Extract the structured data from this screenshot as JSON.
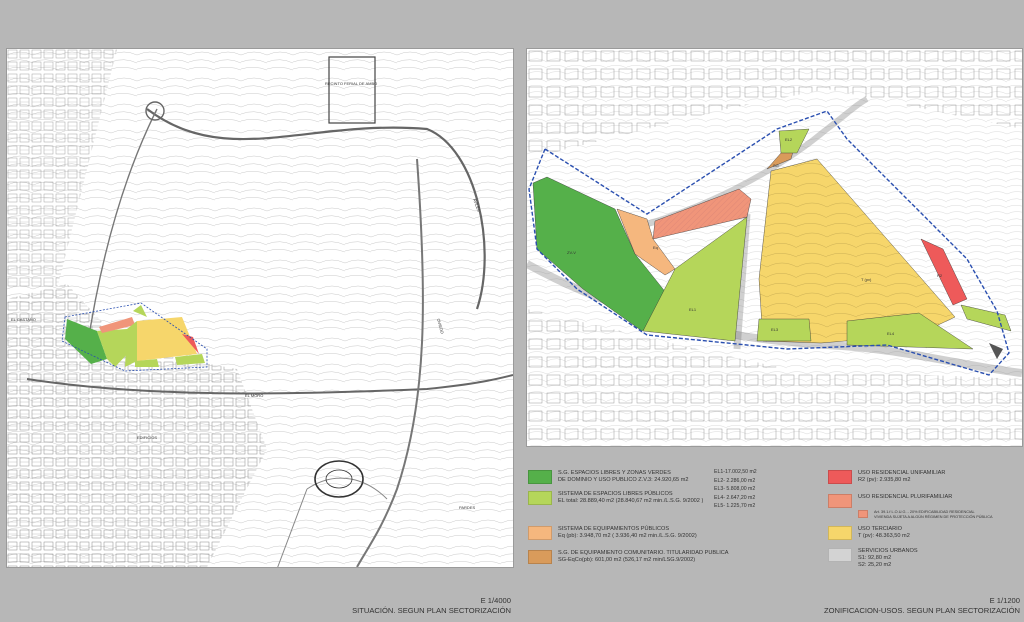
{
  "colors": {
    "background": "#b7b7b7",
    "zv_dark_green": "#55b04a",
    "el_light_green": "#b5d65a",
    "equip_orange": "#f5b77e",
    "sg_equip_brown": "#d99b5b",
    "resid_unifamiliar_red": "#ee5a5a",
    "resid_plurifamiliar_salmon": "#f0957a",
    "terciario_yellow": "#f6d66b",
    "servicios_grey": "#d3d3d3",
    "boundary_blue": "#2a4fb0"
  },
  "left_map": {
    "place_labels": [
      "RECINTO FERIAL DE AMBO",
      "EL CASTAÑO",
      "AVILÉS",
      "OVIEDO",
      "EL MORO",
      "EDIFICIOS",
      "PARDES"
    ],
    "scale": "E 1/4000",
    "title": "SITUACIÓN. SEGUN PLAN SECTORIZACIÓN"
  },
  "right_map": {
    "zone_labels": [
      "ZV-V",
      "EL1",
      "Eq",
      "R2",
      "T (pv)",
      "EL2",
      "EL3",
      "EL4",
      "SG"
    ],
    "scale": "E 1/1200",
    "title": "ZONIFICACION-USOS. SEGUN PLAN SECTORIZACIÓN"
  },
  "legend": {
    "items": [
      {
        "name": "zv",
        "color": "#55b04a",
        "lines": [
          "S.G. ESPACIOS LIBRES Y ZONAS VERDES",
          "DE DOMINIO Y USO PUBLICO    Z.V.3:   24.920,65 m2"
        ]
      },
      {
        "name": "el",
        "color": "#b5d65a",
        "lines": [
          "SISTEMA DE ESPACIOS LIBRES PÚBLICOS",
          "EL total:  28.889,40 m2   (28.840,67 m2  min./L.S.G. 9/2002 )"
        ]
      },
      {
        "name": "eq",
        "color": "#f5b77e",
        "lines": [
          "SISTEMA DE EQUIPAMIENTOS  PÚBLICOS",
          "Eq (pb):  3.948,70 m2 ( 3.936,40 m2  min./L.S.G. 9/2002)"
        ]
      },
      {
        "name": "sg",
        "color": "#d99b5b",
        "lines": [
          "S.G. DE EQUIPAMIENTO COMUNITARIO. TITULARIDAD PUBLICA",
          "SG-EqCo(pb):  601,00 m2  (526,17 m2 min/LSG.9/2002)"
        ]
      },
      {
        "name": "r2",
        "color": "#ee5a5a",
        "lines": [
          "USO RESIDENCIAL UNIFAMILIAR",
          "R2 (pv):  2.935,80 m2"
        ]
      },
      {
        "name": "plur",
        "color": "#f0957a",
        "lines": [
          "USO RESIDENCIAL PLURIFAMILIAR"
        ]
      },
      {
        "name": "plur_note",
        "color": "#f0957a",
        "lines": [
          "Art. 39.1.f L.O.U.G. - 20% EDIFICABILIDAD RESIDENCIAL",
          "VIVIENDA SUJETA A ALGÚN RÉGIMEN DE PROTECCIÓN PÚBLICA"
        ]
      },
      {
        "name": "terc",
        "color": "#f6d66b",
        "lines": [
          "USO TERCIARIO",
          "T (pv):  48.363,50 m2"
        ]
      },
      {
        "name": "serv",
        "color": "#d3d3d3",
        "lines": [
          "SERVICIOS URBANOS",
          "S1:  92,80 m2",
          "S2:  25,20 m2"
        ]
      }
    ],
    "el_breakdown": [
      "EL1-17.002,50 m2",
      "EL2-  2.286,00 m2",
      "EL3-  5.808,00 m2",
      "EL4-  2.647,20 m2",
      "EL5-  1.225,70 m2"
    ]
  }
}
